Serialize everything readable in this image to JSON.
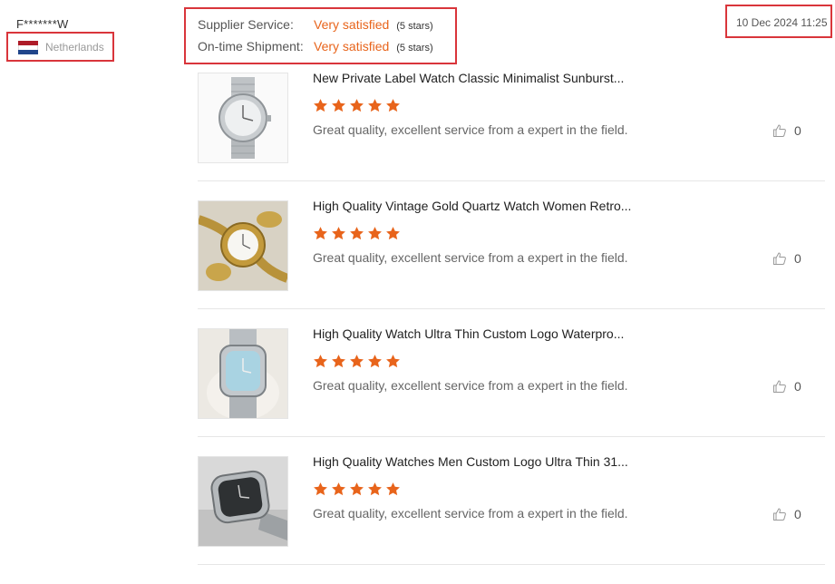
{
  "reviewer": {
    "name": "F*******W",
    "country": "Netherlands",
    "flag_icon": "netherlands-flag-icon"
  },
  "ratings": [
    {
      "label": "Supplier Service:",
      "value": "Very satisfied",
      "stars_text": "(5 stars)"
    },
    {
      "label": "On-time Shipment:",
      "value": "Very satisfied",
      "stars_text": "(5 stars)"
    }
  ],
  "review_date": "10 Dec 2024 11:25",
  "colors": {
    "accent": "#e8641b",
    "highlight_border": "#d9353b"
  },
  "products": [
    {
      "title": "New Private Label Watch Classic Minimalist Sunburst...",
      "rating": 5,
      "comment": "Great quality, excellent service from a expert in the field.",
      "likes": "0",
      "image": "silver-watch-image"
    },
    {
      "title": "High Quality Vintage Gold Quartz Watch Women Retro...",
      "rating": 5,
      "comment": "Great quality, excellent service from a expert in the field.",
      "likes": "0",
      "image": "gold-watch-image"
    },
    {
      "title": "High Quality Watch Ultra Thin Custom Logo Waterpro...",
      "rating": 5,
      "comment": "Great quality, excellent service from a expert in the field.",
      "likes": "0",
      "image": "blue-dial-watch-image"
    },
    {
      "title": "High Quality Watches Men Custom Logo Ultra Thin 31...",
      "rating": 5,
      "comment": "Great quality, excellent service from a expert in the field.",
      "likes": "0",
      "image": "black-dial-watch-image"
    }
  ]
}
